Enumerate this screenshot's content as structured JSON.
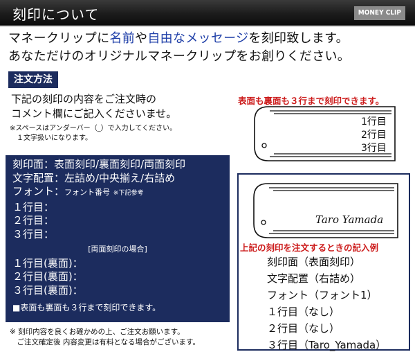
{
  "header": {
    "title": "刻印について",
    "badge": "MONEY CLIP"
  },
  "intro": {
    "line1_a": "マネークリップに",
    "line1_hl1": "名前",
    "line1_b": "や",
    "line1_hl2": "自由なメッセージ",
    "line1_c": "を刻印致します。",
    "line2": "あなただけのオリジナルマネークリップをお創りください。"
  },
  "order": {
    "section_label": "注文方法",
    "instruction_1": "下記の刻印の内容をご注文時の",
    "instruction_2": "コメント欄にご記入くださいませ。",
    "note_1": "※スペースはアンダーバー（_）で入力してください。",
    "note_2": "　１文字扱いになります。"
  },
  "form": {
    "line_side": "刻印面：表面刻印/裏面刻印/両面刻印",
    "line_align": "文字配置：左詰め/中央揃え/右詰め",
    "line_font_label": "フォント：",
    "line_font_value": "フォント番号",
    "line_font_ref": "※下記参考",
    "line_row1": "１行目：",
    "line_row2": "２行目：",
    "line_row3": "３行目：",
    "double_heading": "[両面刻印の場合]",
    "line_back1": "１行目(裏面)：",
    "line_back2": "２行目(裏面)：",
    "line_back3": "３行目(裏面)：",
    "note": "■表面も裏面も３行まで刻印できます。"
  },
  "footnote": {
    "line1": "※ 刻印内容を良くお確かめの上、ご注文お願います。",
    "line2": "　ご注文確定後 内容変更は有料となる場合がございます。"
  },
  "right": {
    "heading": "表面も裏面も３行まで刻印できます。",
    "clip_lines": [
      "1行目",
      "2行目",
      "3行目"
    ]
  },
  "example": {
    "engraved_text": "Taro Yamada",
    "heading": "上記の刻印を注文するときの記入例",
    "lines": [
      "刻印面（表面刻印）",
      "文字配置（右詰め）",
      "フォント（フォント1）",
      "１行目（なし）",
      "２行目（なし）",
      "３行目（Taro_Yamada）"
    ]
  },
  "colors": {
    "navy": "#1c2c5e",
    "accent_blue": "#1f3fa8",
    "red": "#cc1a1a",
    "header_dark": "#1c1c1c"
  }
}
